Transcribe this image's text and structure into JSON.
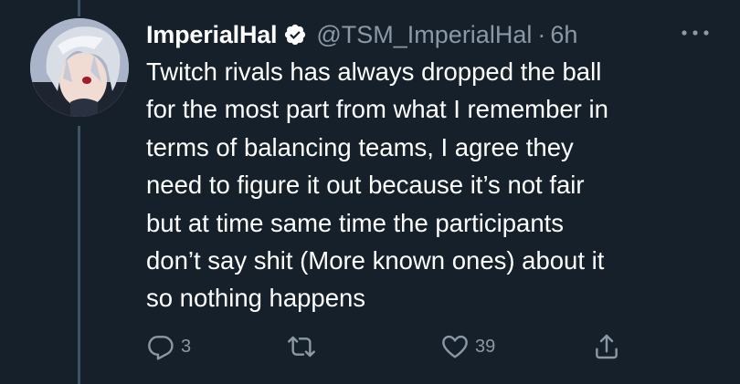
{
  "tweet": {
    "display_name": "ImperialHal",
    "handle": "@TSM_ImperialHal",
    "separator": "·",
    "time": "6h",
    "text_lines": [
      "Twitch rivals has always dropped the ball",
      "for the most part from what I remember in",
      "terms of balancing teams, I agree they",
      "need to figure it out because it’s not fair",
      "but at time same time the participants",
      "don’t say shit (More known ones) about it",
      "so nothing happens"
    ],
    "reply_count": "3",
    "retweet_count": "",
    "like_count": "39"
  },
  "icons": {
    "verified": "verified-badge-icon",
    "more": "more-dots-icon",
    "reply": "reply-icon",
    "retweet": "retweet-icon",
    "like": "heart-icon",
    "share": "share-icon"
  },
  "colors": {
    "background": "#15202b",
    "text": "#ffffff",
    "secondary": "#8b98a5",
    "thread_line": "#3d5466"
  }
}
